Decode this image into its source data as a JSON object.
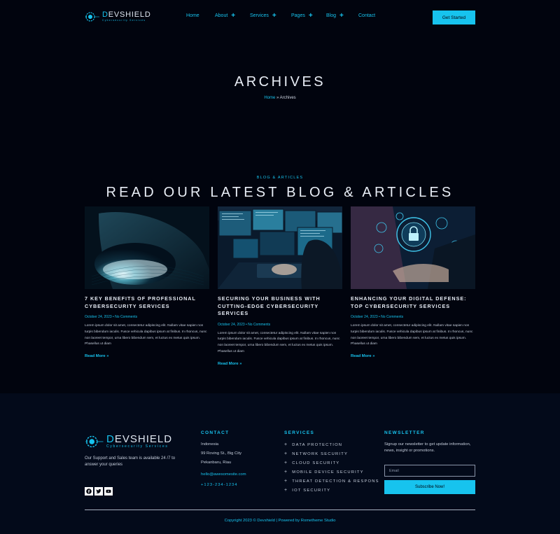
{
  "header": {
    "logo": {
      "name_first": "D",
      "name_rest": "EVSHIELD",
      "subtitle": "Cybersecurity Services"
    },
    "nav": [
      {
        "label": "Home",
        "has_plus": false
      },
      {
        "label": "About",
        "has_plus": true
      },
      {
        "label": "Services",
        "has_plus": true
      },
      {
        "label": "Pages",
        "has_plus": true
      },
      {
        "label": "Blog",
        "has_plus": true
      },
      {
        "label": "Contact",
        "has_plus": false
      }
    ],
    "cta_label": "Get Started"
  },
  "hero": {
    "title": "ARCHIVES",
    "breadcrumb": {
      "home": "Home",
      "separator": " » ",
      "current": "Archives"
    }
  },
  "blog": {
    "eyebrow": "BLOG & ARTICLES",
    "title": "READ OUR LATEST BLOG & ARTICLES",
    "posts": [
      {
        "title": "7 KEY BENEFITS OF PROFESSIONAL CYBERSECURITY SERVICES",
        "meta": "October 24, 2023 • No Comments",
        "excerpt": "Lorem ipsum dolor sit amet, consectetur adipiscing elit. Nullam vitae sapien non turpis bibendum iaculis. Fusce vehicula dapibus ipsum at finibus. In rhoncus, nunc non laoreet tempor, urna libero bibendum sem, et luctus ex metus quis ipsum. Phasellus ut diam",
        "read_more": "Read More »",
        "image": "fingerprint-finger-image"
      },
      {
        "title": "SECURING YOUR BUSINESS WITH CUTTING-EDGE CYBERSECURITY SERVICES",
        "meta": "October 24, 2023 • No Comments",
        "excerpt": "Lorem ipsum dolor sit amet, consectetur adipiscing elit. Nullam vitae sapien non turpis bibendum iaculis. Fusce vehicula dapibus ipsum at finibus. In rhoncus, nunc non laoreet tempor, urna libero bibendum sem, et luctus ex metus quis ipsum. Phasellus ut diam",
        "read_more": "Read More »",
        "image": "monitors-workstation-image"
      },
      {
        "title": "ENHANCING YOUR DIGITAL DEFENSE: TOP CYBERSECURITY SERVICES",
        "meta": "October 24, 2023 • No Comments",
        "excerpt": "Lorem ipsum dolor sit amet, consectetur adipiscing elit. Nullam vitae sapien non turpis bibendum iaculis. Fusce vehicula dapibus ipsum at finibus. In rhoncus, nunc non laoreet tempor, urna libero bibendum sem, et luctus ex metus quis ipsum. Phasellus ut diam",
        "read_more": "Read More »",
        "image": "padlock-hologram-laptop-image"
      }
    ]
  },
  "footer": {
    "logo": {
      "name_first": "D",
      "name_rest": "EVSHIELD",
      "subtitle": "Cybersecurity Services"
    },
    "tagline": "Our Support and Sales team is available 24 /7 to answer your queries",
    "socials": [
      "facebook-icon",
      "twitter-icon",
      "youtube-icon"
    ],
    "contact": {
      "heading": "CONTACT",
      "country": "Indonesia",
      "street": "99 Roving St., Big City",
      "city": "Pekanbaru, Riau",
      "email": "hello@awesomesite.com",
      "phone": "+123-234-1234"
    },
    "services": {
      "heading": "SERVICES",
      "items": [
        "DATA PROTECTION",
        "NETWORK SECURITY",
        "CLOUD SECURITY",
        "MOBILE DEVICE SECURITY",
        "THREAT DETECTION & RESPONS",
        "IOT SECURITY"
      ]
    },
    "newsletter": {
      "heading": "NEWSLETTER",
      "text": "Signup our newsletter to get update information, news, insight or promotions.",
      "placeholder": "Email",
      "button": "Subscribe Now!"
    },
    "copyright": "Copyright 2023 © Devshield | Powered by Rometheme Studio"
  },
  "colors": {
    "accent": "#17c3ee",
    "background": "#01040e",
    "footer_bg": "#030a1a"
  }
}
